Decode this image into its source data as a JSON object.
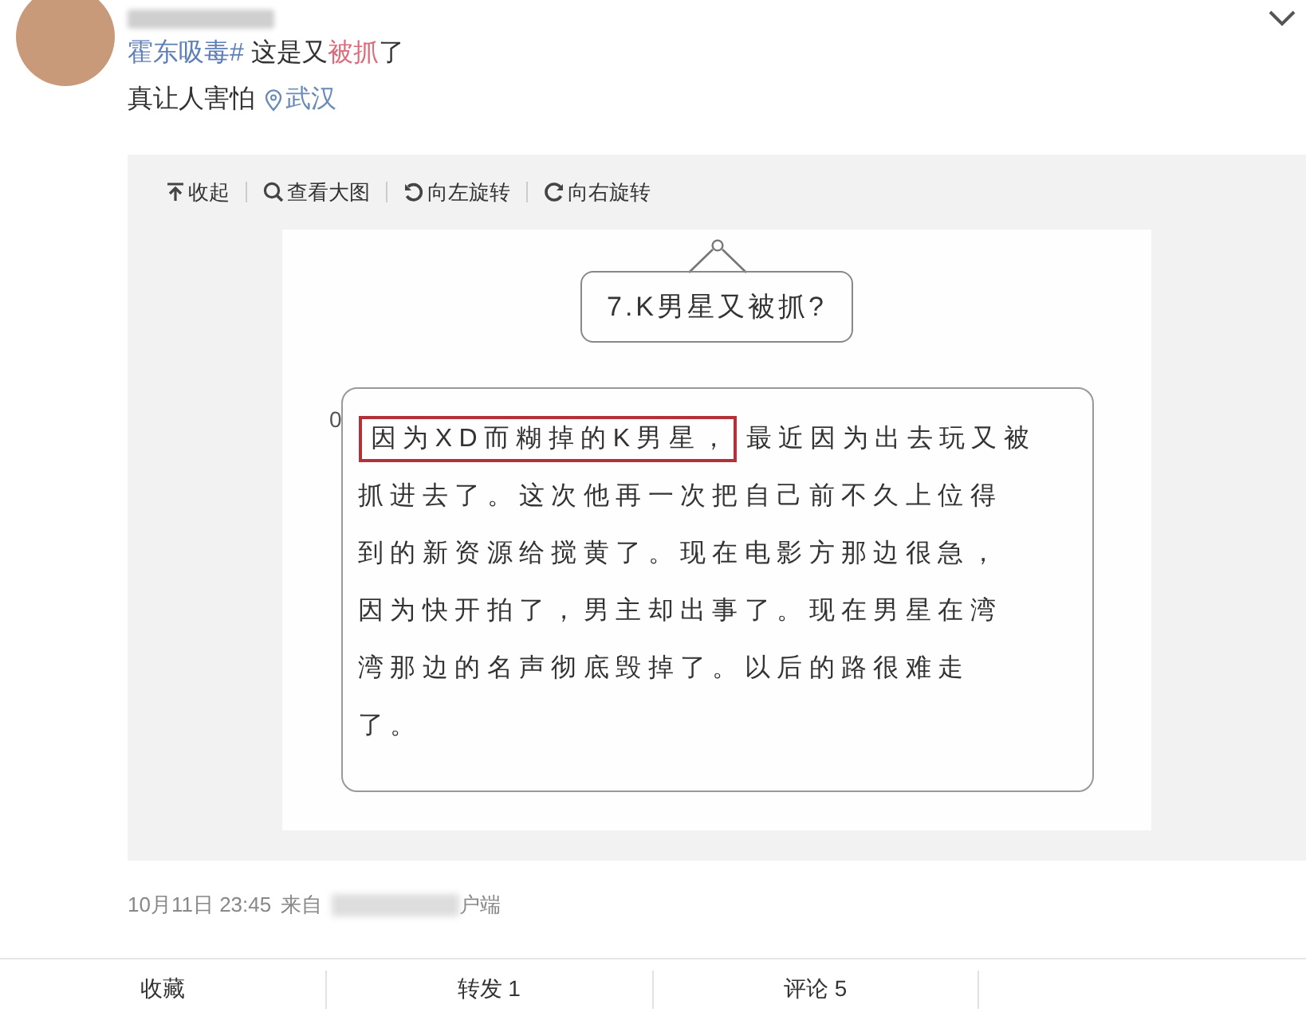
{
  "post": {
    "segments": [
      {
        "kind": "hashtag",
        "text": "霍东吸毒#"
      },
      {
        "kind": "plain",
        "text": " 这是又"
      },
      {
        "kind": "keyword",
        "text": "被抓"
      },
      {
        "kind": "plain",
        "text": "了"
      }
    ],
    "line2": "真让人害怕",
    "location": "武汉"
  },
  "toolbar": [
    "收起",
    "查看大图",
    "向左旋转",
    "向右旋转"
  ],
  "article": {
    "title": "7.K男星又被抓?",
    "marker": "0",
    "highlight": "因为XD而糊掉的K男星，",
    "lines": [
      "最近因为出去玩又被",
      "抓进去了。这次他再一次把自己前不久上位得",
      "到的新资源给搅黄了。现在电影方那边很急，",
      "因为快开拍了，男主却出事了。现在男星在湾",
      "湾那边的名声彻底毁掉了。以后的路很难走",
      "了。"
    ]
  },
  "footer": {
    "time": "10月11日 23:45",
    "source_start": "来自",
    "source_end": "户端"
  },
  "actions": [
    "收藏",
    "转发 1",
    "评论 5"
  ]
}
